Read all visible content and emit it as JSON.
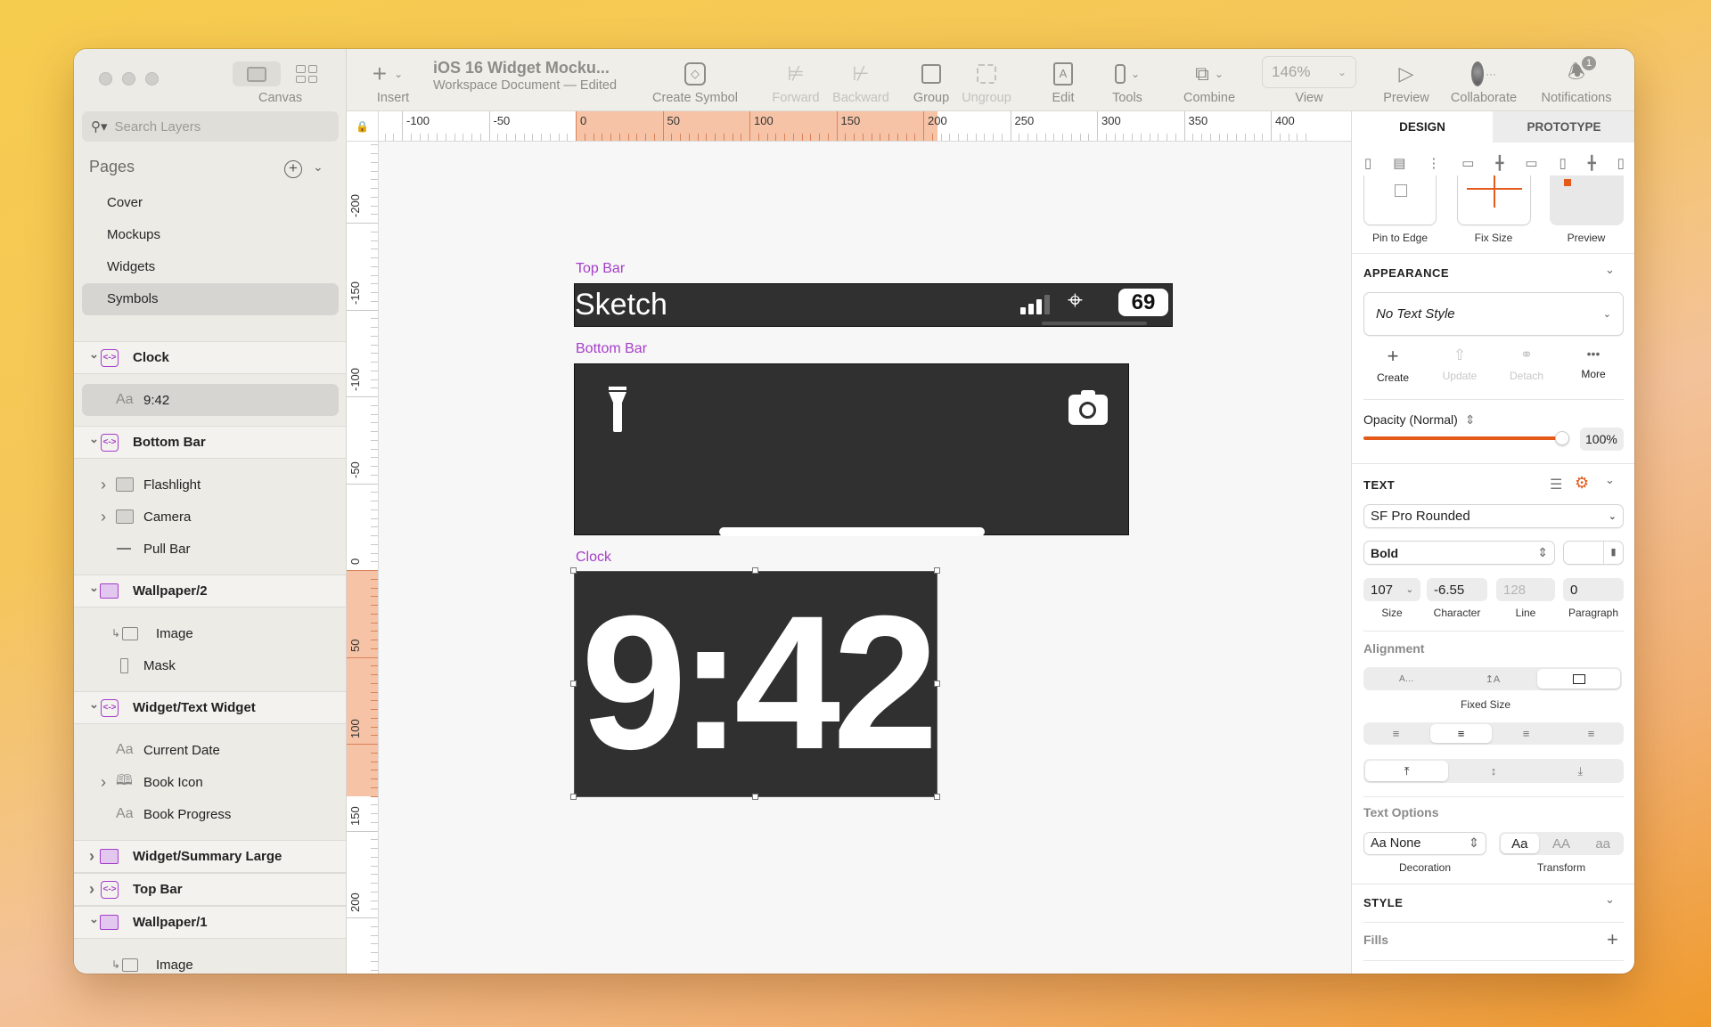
{
  "window": {
    "title": "iOS 16 Widget Mocku...",
    "subtitle": "Workspace Document — Edited",
    "canvas_label": "Canvas"
  },
  "toolbar": {
    "insert": "Insert",
    "create_symbol": "Create Symbol",
    "forward": "Forward",
    "backward": "Backward",
    "group": "Group",
    "ungroup": "Ungroup",
    "edit": "Edit",
    "tools": "Tools",
    "combine": "Combine",
    "zoom_value": "146%",
    "view": "View",
    "preview": "Preview",
    "collaborate": "Collaborate",
    "notifications": "Notifications",
    "notification_count": "1"
  },
  "sidebar": {
    "search_placeholder": "Search Layers",
    "pages_title": "Pages",
    "pages": [
      {
        "label": "Cover",
        "selected": false
      },
      {
        "label": "Mockups",
        "selected": false
      },
      {
        "label": "Widgets",
        "selected": false
      },
      {
        "label": "Symbols",
        "selected": true
      }
    ],
    "layers": [
      {
        "label": "Clock",
        "icon": "symbol-icon",
        "expanded": true,
        "children": [
          {
            "label": "9:42",
            "icon": "text-layer-icon",
            "selected": true
          }
        ]
      },
      {
        "label": "Bottom Bar",
        "icon": "symbol-icon",
        "expanded": true,
        "children": [
          {
            "label": "Flashlight",
            "icon": "folder-icon",
            "collapsible": true
          },
          {
            "label": "Camera",
            "icon": "folder-icon",
            "collapsible": true
          },
          {
            "label": "Pull Bar",
            "icon": "line-icon"
          }
        ]
      },
      {
        "label": "Wallpaper/2",
        "icon": "artboard-icon",
        "expanded": true,
        "children": [
          {
            "label": "Image",
            "icon": "masked-image-icon"
          },
          {
            "label": "Mask",
            "icon": "rectangle-icon"
          }
        ]
      },
      {
        "label": "Widget/Text Widget",
        "icon": "symbol-icon",
        "expanded": true,
        "children": [
          {
            "label": "Current Date",
            "icon": "text-layer-icon"
          },
          {
            "label": "Book Icon",
            "icon": "book-icon",
            "collapsible": true
          },
          {
            "label": "Book Progress",
            "icon": "text-layer-icon"
          }
        ]
      },
      {
        "label": "Widget/Summary Large",
        "icon": "artboard-icon",
        "expanded": false
      },
      {
        "label": "Top Bar",
        "icon": "symbol-icon",
        "expanded": false
      },
      {
        "label": "Wallpaper/1",
        "icon": "artboard-icon",
        "expanded": true,
        "children": [
          {
            "label": "Image",
            "icon": "masked-image-icon"
          }
        ]
      }
    ]
  },
  "rulers": {
    "horizontal": [
      -100,
      -50,
      0,
      50,
      100,
      150,
      200,
      250,
      300,
      350,
      400
    ],
    "vertical": [
      -200,
      -150,
      -100,
      -50,
      0,
      50,
      100,
      150,
      200
    ],
    "selection_x": [
      0,
      208
    ],
    "selection_y": [
      0,
      130
    ]
  },
  "canvas": {
    "top_bar": {
      "label": "Top Bar",
      "app_name": "Sketch",
      "battery": "69"
    },
    "bottom_bar": {
      "label": "Bottom Bar"
    },
    "clock": {
      "label": "Clock",
      "time": "9:42"
    }
  },
  "inspector": {
    "tabs": [
      {
        "label": "DESIGN",
        "active": true
      },
      {
        "label": "PROTOTYPE",
        "active": false
      }
    ],
    "resizing": {
      "pin_to_edge": "Pin to Edge",
      "fix_size": "Fix Size",
      "preview": "Preview"
    },
    "appearance": {
      "title": "APPEARANCE",
      "text_style": "No Text Style",
      "create": "Create",
      "update": "Update",
      "detach": "Detach",
      "more": "More",
      "opacity_label": "Opacity (Normal)",
      "opacity_value": "100%",
      "opacity_fraction": 1.0
    },
    "text": {
      "title": "TEXT",
      "font_family": "SF Pro Rounded",
      "font_weight": "Bold",
      "size": "107",
      "size_label": "Size",
      "character": "-6.55",
      "character_label": "Character",
      "line": "128",
      "line_label": "Line",
      "paragraph": "0",
      "paragraph_label": "Paragraph",
      "alignment_label": "Alignment",
      "sizing_mode": "Fixed Size",
      "text_options_label": "Text Options",
      "decoration": "Aa None",
      "decoration_label": "Decoration",
      "transform_options": [
        "Aa",
        "AA",
        "aa"
      ],
      "transform_label": "Transform"
    },
    "style": {
      "title": "STYLE",
      "fills": "Fills"
    },
    "accent_color": "#e35a1b",
    "symbol_color": "#a53ec9"
  }
}
